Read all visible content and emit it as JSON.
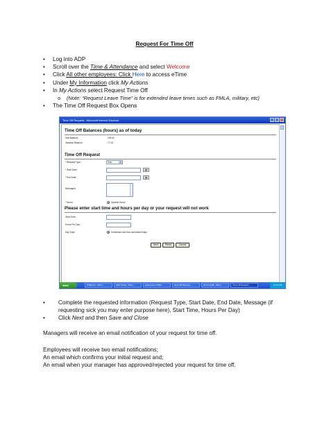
{
  "title": "Request For Time Off",
  "steps": {
    "s1": "Log into ADP",
    "s2_pre": "Scroll over the ",
    "s2_em": "Time & Attendance",
    "s2_mid": " and select ",
    "s2_red": "Welcome",
    "s3_pre": "Click ",
    "s3_u1": "All other employees: Click ",
    "s3_link": "Here",
    "s3_post": " to access eTime",
    "s4_pre": "Under ",
    "s4_u": "My Information",
    "s4_mid": " click ",
    "s4_em": "My Actions",
    "s5_pre": "In ",
    "s5_em": "My Actions",
    "s5_post": " select Request Time Off",
    "note": "(Note: “Request Leave Time” is for extended leave times such as FMLA, military, etc)",
    "s6": "The Time Off Request Box Opens"
  },
  "screenshot": {
    "window_title": "Time Off Request - Microsoft Internet Explorer",
    "balances_heading": "Time Off Balances (hours) as of today",
    "sick_label": "Sick Balance:",
    "sick_value": "108.52",
    "vacation_label": "Vacation Balance:",
    "vacation_value": "77.43",
    "request_heading": "Time Off Request",
    "request_type_label": "* Request Type:",
    "request_type_value": "Sick",
    "start_date_label": "* Start Date:",
    "end_date_label": "* End Date:",
    "messages_label": "Messages:",
    "hours_label": "* Hours:",
    "specific_hours": "Specific Hours",
    "enter_heading": "Please enter start time and hours per day or your request will not work",
    "start_time_label": "Start Time:",
    "hours_per_day_label": "Hours Per Day:",
    "day_type_label": "Day Type:",
    "day_type_option": "Scheduled and Non-scheduled Days",
    "next_label": "Next",
    "reset_label": "Reset",
    "cancel_label": "Cancel",
    "start_label": "start",
    "tasks": [
      "WSIE PH - Micro...",
      "ADP Portal - Micro...",
      "Enterprise eTIME...",
      "New Off Request ...",
      "Document8 - Micro...",
      "Time Off Request ..."
    ],
    "clock": "12:10 PM"
  },
  "steps2": {
    "c1": "Complete the requested information (Request Type, Start Date, End Date, Message (if requesting sick you may enter purpose here), Start Time, Hours Per Day)",
    "c2_pre": "Click ",
    "c2_em1": "Next",
    "c2_mid": " and then ",
    "c2_em2": "Save and Close"
  },
  "paragraphs": {
    "p1": "Managers will receive an email notification of your request for time off.",
    "p2": "Employees will receive two email notifications;",
    "p3": " An email which confirms your initial request and;",
    "p4": " An email when your manager has approved/rejected your request for time off."
  }
}
